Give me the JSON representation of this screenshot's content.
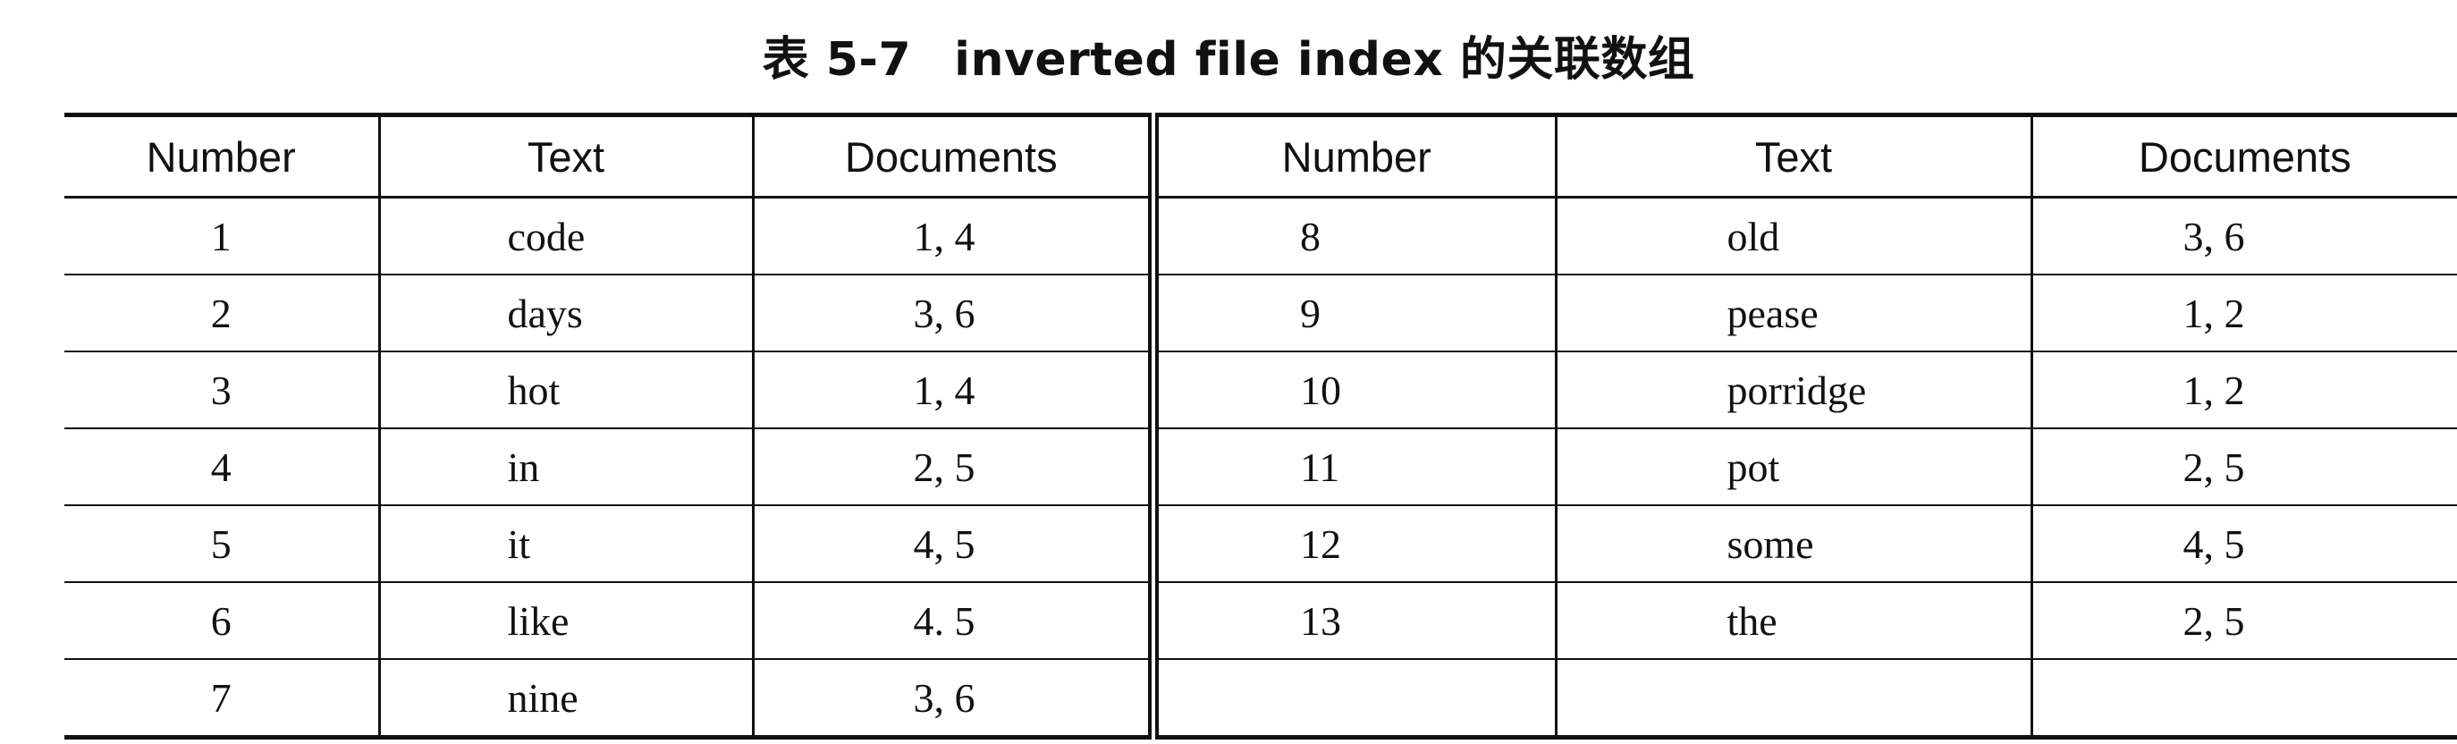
{
  "caption": {
    "label": "表 5-7",
    "title": "inverted file index 的关联数组"
  },
  "table": {
    "headers": [
      "Number",
      "Text",
      "Documents",
      "Number",
      "Text",
      "Documents"
    ],
    "rows": [
      [
        "1",
        "code",
        "1, 4",
        "8",
        "old",
        "3, 6"
      ],
      [
        "2",
        "days",
        "3, 6",
        "9",
        "pease",
        "1, 2"
      ],
      [
        "3",
        "hot",
        "1, 4",
        "10",
        "porridge",
        "1, 2"
      ],
      [
        "4",
        "in",
        "2, 5",
        "11",
        "pot",
        "2, 5"
      ],
      [
        "5",
        "it",
        "4, 5",
        "12",
        "some",
        "4, 5"
      ],
      [
        "6",
        "like",
        "4. 5",
        "13",
        "the",
        "2, 5"
      ],
      [
        "7",
        "nine",
        "3, 6",
        "",
        "",
        ""
      ]
    ]
  }
}
